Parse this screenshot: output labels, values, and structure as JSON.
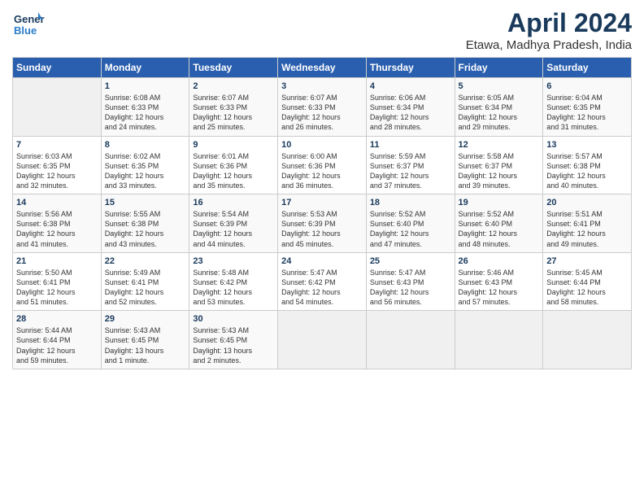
{
  "header": {
    "logo_general": "General",
    "logo_blue": "Blue",
    "title": "April 2024",
    "subtitle": "Etawa, Madhya Pradesh, India"
  },
  "days_of_week": [
    "Sunday",
    "Monday",
    "Tuesday",
    "Wednesday",
    "Thursday",
    "Friday",
    "Saturday"
  ],
  "weeks": [
    [
      {
        "day": "",
        "info": ""
      },
      {
        "day": "1",
        "info": "Sunrise: 6:08 AM\nSunset: 6:33 PM\nDaylight: 12 hours\nand 24 minutes."
      },
      {
        "day": "2",
        "info": "Sunrise: 6:07 AM\nSunset: 6:33 PM\nDaylight: 12 hours\nand 25 minutes."
      },
      {
        "day": "3",
        "info": "Sunrise: 6:07 AM\nSunset: 6:33 PM\nDaylight: 12 hours\nand 26 minutes."
      },
      {
        "day": "4",
        "info": "Sunrise: 6:06 AM\nSunset: 6:34 PM\nDaylight: 12 hours\nand 28 minutes."
      },
      {
        "day": "5",
        "info": "Sunrise: 6:05 AM\nSunset: 6:34 PM\nDaylight: 12 hours\nand 29 minutes."
      },
      {
        "day": "6",
        "info": "Sunrise: 6:04 AM\nSunset: 6:35 PM\nDaylight: 12 hours\nand 31 minutes."
      }
    ],
    [
      {
        "day": "7",
        "info": "Sunrise: 6:03 AM\nSunset: 6:35 PM\nDaylight: 12 hours\nand 32 minutes."
      },
      {
        "day": "8",
        "info": "Sunrise: 6:02 AM\nSunset: 6:35 PM\nDaylight: 12 hours\nand 33 minutes."
      },
      {
        "day": "9",
        "info": "Sunrise: 6:01 AM\nSunset: 6:36 PM\nDaylight: 12 hours\nand 35 minutes."
      },
      {
        "day": "10",
        "info": "Sunrise: 6:00 AM\nSunset: 6:36 PM\nDaylight: 12 hours\nand 36 minutes."
      },
      {
        "day": "11",
        "info": "Sunrise: 5:59 AM\nSunset: 6:37 PM\nDaylight: 12 hours\nand 37 minutes."
      },
      {
        "day": "12",
        "info": "Sunrise: 5:58 AM\nSunset: 6:37 PM\nDaylight: 12 hours\nand 39 minutes."
      },
      {
        "day": "13",
        "info": "Sunrise: 5:57 AM\nSunset: 6:38 PM\nDaylight: 12 hours\nand 40 minutes."
      }
    ],
    [
      {
        "day": "14",
        "info": "Sunrise: 5:56 AM\nSunset: 6:38 PM\nDaylight: 12 hours\nand 41 minutes."
      },
      {
        "day": "15",
        "info": "Sunrise: 5:55 AM\nSunset: 6:38 PM\nDaylight: 12 hours\nand 43 minutes."
      },
      {
        "day": "16",
        "info": "Sunrise: 5:54 AM\nSunset: 6:39 PM\nDaylight: 12 hours\nand 44 minutes."
      },
      {
        "day": "17",
        "info": "Sunrise: 5:53 AM\nSunset: 6:39 PM\nDaylight: 12 hours\nand 45 minutes."
      },
      {
        "day": "18",
        "info": "Sunrise: 5:52 AM\nSunset: 6:40 PM\nDaylight: 12 hours\nand 47 minutes."
      },
      {
        "day": "19",
        "info": "Sunrise: 5:52 AM\nSunset: 6:40 PM\nDaylight: 12 hours\nand 48 minutes."
      },
      {
        "day": "20",
        "info": "Sunrise: 5:51 AM\nSunset: 6:41 PM\nDaylight: 12 hours\nand 49 minutes."
      }
    ],
    [
      {
        "day": "21",
        "info": "Sunrise: 5:50 AM\nSunset: 6:41 PM\nDaylight: 12 hours\nand 51 minutes."
      },
      {
        "day": "22",
        "info": "Sunrise: 5:49 AM\nSunset: 6:41 PM\nDaylight: 12 hours\nand 52 minutes."
      },
      {
        "day": "23",
        "info": "Sunrise: 5:48 AM\nSunset: 6:42 PM\nDaylight: 12 hours\nand 53 minutes."
      },
      {
        "day": "24",
        "info": "Sunrise: 5:47 AM\nSunset: 6:42 PM\nDaylight: 12 hours\nand 54 minutes."
      },
      {
        "day": "25",
        "info": "Sunrise: 5:47 AM\nSunset: 6:43 PM\nDaylight: 12 hours\nand 56 minutes."
      },
      {
        "day": "26",
        "info": "Sunrise: 5:46 AM\nSunset: 6:43 PM\nDaylight: 12 hours\nand 57 minutes."
      },
      {
        "day": "27",
        "info": "Sunrise: 5:45 AM\nSunset: 6:44 PM\nDaylight: 12 hours\nand 58 minutes."
      }
    ],
    [
      {
        "day": "28",
        "info": "Sunrise: 5:44 AM\nSunset: 6:44 PM\nDaylight: 12 hours\nand 59 minutes."
      },
      {
        "day": "29",
        "info": "Sunrise: 5:43 AM\nSunset: 6:45 PM\nDaylight: 13 hours\nand 1 minute."
      },
      {
        "day": "30",
        "info": "Sunrise: 5:43 AM\nSunset: 6:45 PM\nDaylight: 13 hours\nand 2 minutes."
      },
      {
        "day": "",
        "info": ""
      },
      {
        "day": "",
        "info": ""
      },
      {
        "day": "",
        "info": ""
      },
      {
        "day": "",
        "info": ""
      }
    ]
  ]
}
